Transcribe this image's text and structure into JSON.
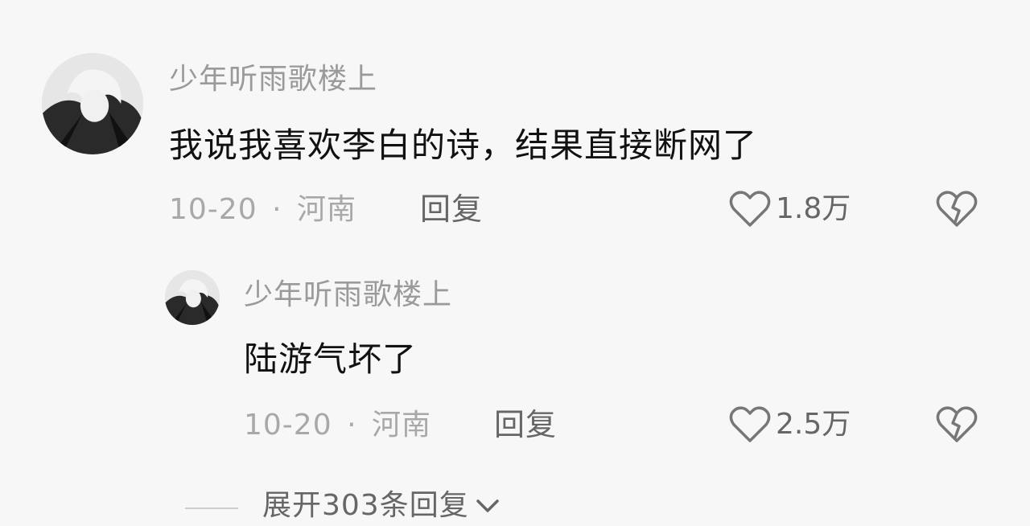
{
  "comments": [
    {
      "username": "少年听雨歌楼上",
      "text": "我说我喜欢李白的诗，结果直接断网了",
      "date": "10-20",
      "separator": "·",
      "location": "河南",
      "reply_label": "回复",
      "likes": "1.8万",
      "avatar_icon": "anime-avatar-icon"
    },
    {
      "username": "少年听雨歌楼上",
      "text": "陆游气坏了",
      "date": "10-20",
      "separator": "·",
      "location": "河南",
      "reply_label": "回复",
      "likes": "2.5万",
      "avatar_icon": "anime-avatar-icon"
    }
  ],
  "expand": {
    "label": "展开303条回复"
  },
  "icons": {
    "like": "heart-outline-icon",
    "dislike": "broken-heart-icon",
    "expand": "chevron-down-icon"
  },
  "colors": {
    "background": "#f7f7f7",
    "username": "#9a9a9a",
    "text": "#111111",
    "meta": "#a8a8a8",
    "icon": "#777777"
  }
}
